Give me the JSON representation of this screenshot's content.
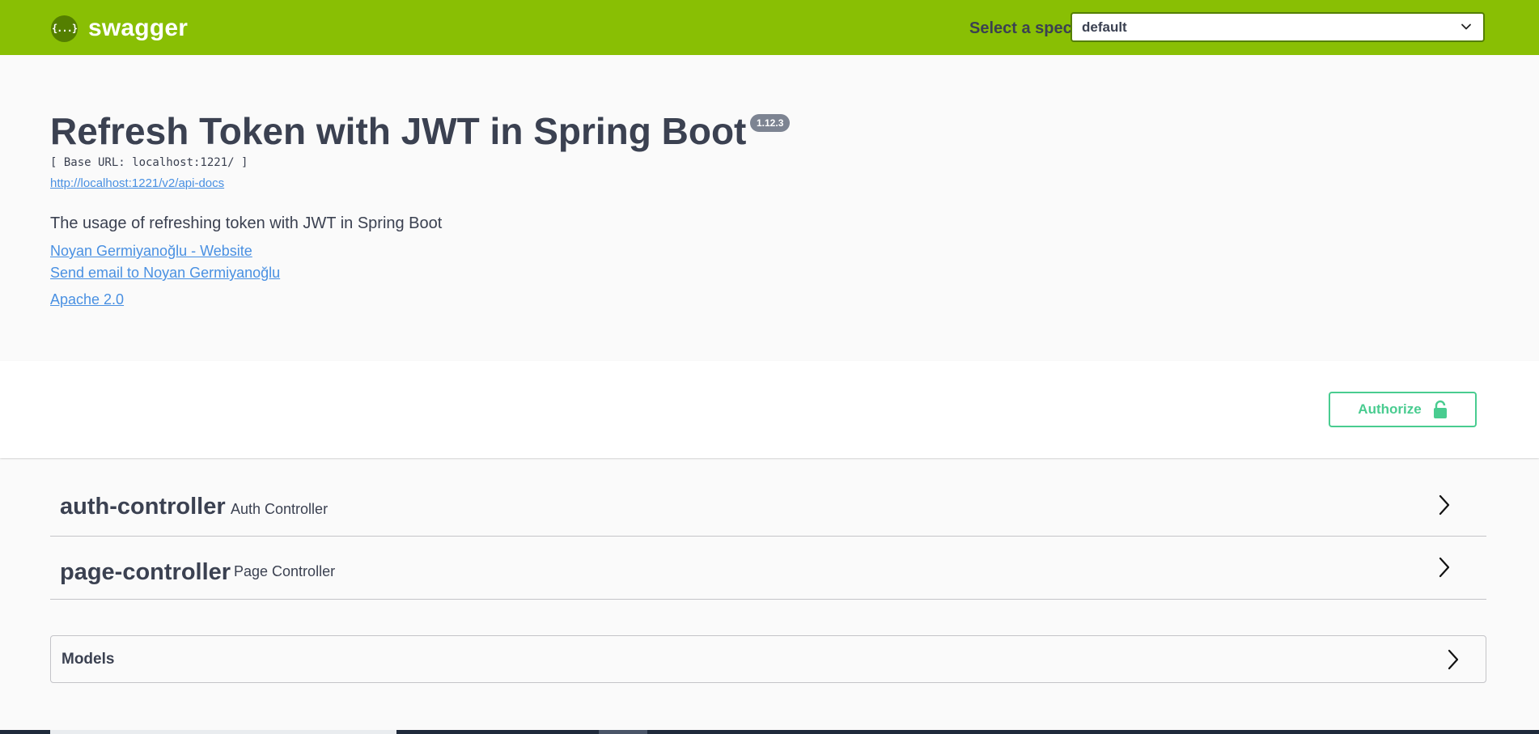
{
  "topbar": {
    "logo_icon": "{...}",
    "logo_text": "swagger",
    "spec_label": "Select a spec",
    "spec_value": "default"
  },
  "info": {
    "title": "Refresh Token with JWT in Spring Boot",
    "version": "1.12.3",
    "base_url": "[ Base URL: localhost:1221/ ]",
    "api_docs_link": "http://localhost:1221/v2/api-docs",
    "description": "The usage of refreshing token with JWT in Spring Boot",
    "website_link": "Noyan Germiyanoğlu - Website",
    "email_link": "Send email to Noyan Germiyanoğlu",
    "license_link": "Apache 2.0"
  },
  "authorize": {
    "label": "Authorize",
    "icon": "unlock-icon"
  },
  "tags": [
    {
      "name": "auth-controller",
      "description": "Auth Controller"
    },
    {
      "name": "page-controller",
      "description": "Page Controller"
    }
  ],
  "models": {
    "label": "Models"
  },
  "colors": {
    "topbar": "#89bf04",
    "accent": "#49cc90",
    "link": "#4990e2",
    "text": "#3b4151"
  }
}
